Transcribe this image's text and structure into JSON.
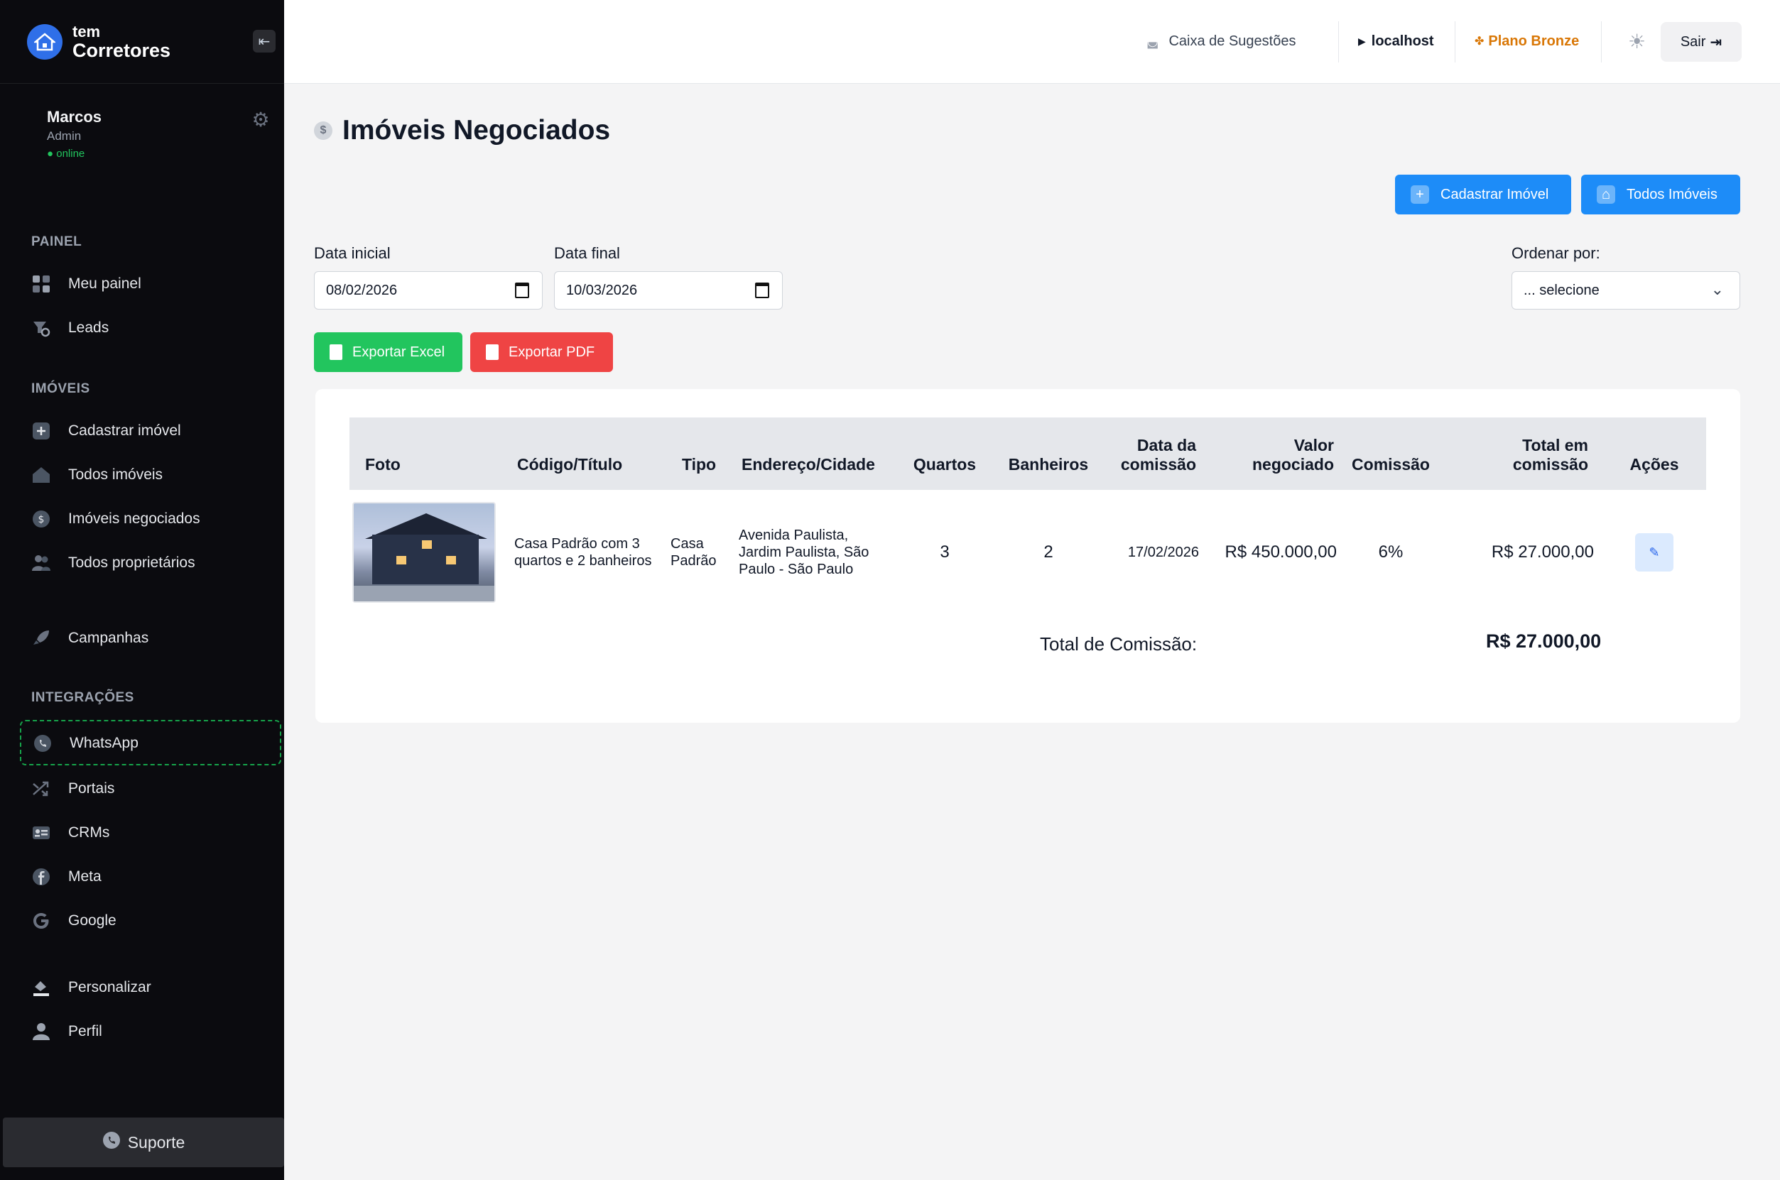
{
  "brand": {
    "line1": "tem",
    "line2": "Corretores"
  },
  "user": {
    "name": "Marcos",
    "role": "Admin",
    "status": "● online"
  },
  "sidebar": {
    "sections": {
      "painel": "PAINEL",
      "imoveis": "IMÓVEIS",
      "integracoes": "INTEGRAÇÕES"
    },
    "items": [
      {
        "label": "Meu painel",
        "icon": "grid-icon"
      },
      {
        "label": "Leads",
        "icon": "leads-icon"
      },
      {
        "label": "Cadastrar imóvel",
        "icon": "plus-icon"
      },
      {
        "label": "Todos imóveis",
        "icon": "house-icon"
      },
      {
        "label": "Imóveis negociados",
        "icon": "dollar-icon"
      },
      {
        "label": "Todos proprietários",
        "icon": "users-icon"
      },
      {
        "label": "Campanhas",
        "icon": "rocket-icon"
      },
      {
        "label": "WhatsApp",
        "icon": "whatsapp-icon"
      },
      {
        "label": "Portais",
        "icon": "shuffle-icon"
      },
      {
        "label": "CRMs",
        "icon": "crm-icon"
      },
      {
        "label": "Meta",
        "icon": "facebook-icon"
      },
      {
        "label": "Google",
        "icon": "google-icon"
      },
      {
        "label": "Personalizar",
        "icon": "paint-icon"
      },
      {
        "label": "Perfil",
        "icon": "user-icon"
      }
    ],
    "support": "Suporte"
  },
  "topbar": {
    "suggestions": "Caixa de Sugestões",
    "host": "localhost",
    "plan": "Plano Bronze",
    "logout": "Sair"
  },
  "page": {
    "title": "Imóveis Negociados",
    "btn_register": "Cadastrar Imóvel",
    "btn_all": "Todos Imóveis",
    "filters": {
      "start_label": "Data inicial",
      "start_value": "08/02/2026",
      "end_label": "Data final",
      "end_value": "10/03/2026",
      "order_label": "Ordenar por:",
      "order_value": "... selecione"
    },
    "btn_excel": "Exportar Excel",
    "btn_pdf": "Exportar PDF"
  },
  "table": {
    "headers": [
      "Foto",
      "Código/Título",
      "Tipo",
      "Endereço/Cidade",
      "Quartos",
      "Banheiros",
      "Data da comissão",
      "Valor negociado",
      "Comissão",
      "Total em comissão",
      "Ações"
    ],
    "rows": [
      {
        "title": "Casa Padrão com 3 quartos e 2 banheiros",
        "type": "Casa Padrão",
        "address": "Avenida Paulista, Jardim Paulista, São Paulo - São Paulo",
        "bedrooms": "3",
        "bathrooms": "2",
        "date": "17/02/2026",
        "value": "R$ 450.000,00",
        "commission": "6%",
        "total": "R$ 27.000,00"
      }
    ],
    "total_label": "Total de Comissão:",
    "total_value": "R$ 27.000,00"
  },
  "colors": {
    "primary": "#1d8cf8",
    "green": "#22c55e",
    "red": "#ef4444",
    "plan": "#d97706",
    "sidebar": "#0b0b0f"
  }
}
